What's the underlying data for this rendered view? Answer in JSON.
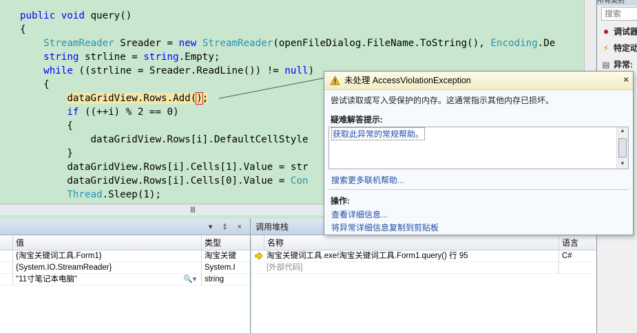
{
  "editor": {
    "lines": [
      [
        {
          "t": "public",
          "c": "kw"
        },
        {
          "t": " "
        },
        {
          "t": "void",
          "c": "kw"
        },
        {
          "t": " query()"
        }
      ],
      [
        {
          "t": "{"
        }
      ],
      [
        {
          "t": "    "
        },
        {
          "t": "StreamReader",
          "c": "ty"
        },
        {
          "t": " Sreader = "
        },
        {
          "t": "new",
          "c": "kw"
        },
        {
          "t": " "
        },
        {
          "t": "StreamReader",
          "c": "ty"
        },
        {
          "t": "(openFileDialog.FileName.ToString(), "
        },
        {
          "t": "Encoding",
          "c": "ty"
        },
        {
          "t": ".De"
        }
      ],
      [
        {
          "t": "    "
        },
        {
          "t": "string",
          "c": "kw"
        },
        {
          "t": " strline = "
        },
        {
          "t": "string",
          "c": "kw"
        },
        {
          "t": ".Empty;"
        }
      ],
      [
        {
          "t": "    "
        },
        {
          "t": "while",
          "c": "kw"
        },
        {
          "t": " ((strline = Sreader.ReadLine()) != "
        },
        {
          "t": "null",
          "c": "kw"
        },
        {
          "t": ")"
        }
      ],
      [
        {
          "t": "    {"
        }
      ],
      [
        {
          "t": "        "
        },
        {
          "t": "dataGridView.Rows.Add(",
          "c": "hl"
        },
        {
          "t": ")",
          "c": "hl hl-paren"
        },
        {
          "t": ";",
          "c": "hl"
        }
      ],
      [
        {
          "t": "        "
        },
        {
          "t": "if",
          "c": "kw"
        },
        {
          "t": " ((++i) % 2 == 0)"
        }
      ],
      [
        {
          "t": "        {"
        }
      ],
      [
        {
          "t": "            dataGridView.Rows[i].DefaultCellStyle"
        }
      ],
      [
        {
          "t": "        }"
        }
      ],
      [
        {
          "t": "        dataGridView.Rows[i].Cells[1].Value = str"
        }
      ],
      [
        {
          "t": "        dataGridView.Rows[i].Cells[0].Value = "
        },
        {
          "t": "Con",
          "c": "ty"
        }
      ],
      [
        {
          "t": "        "
        },
        {
          "t": "Thread",
          "c": "ty"
        },
        {
          "t": ".Sleep(1);"
        }
      ]
    ],
    "hscroll_grip": "III"
  },
  "locals": {
    "title": "",
    "buttons": "▾ ‡ ×",
    "columns": {
      "value": "值",
      "type": "类型"
    },
    "rows": [
      {
        "value": "{淘宝关键词工具.Form1}",
        "type": "淘宝关键"
      },
      {
        "value": "{System.IO.StreamReader}",
        "type": "System.I"
      },
      {
        "value": "\"11寸笔记本电脑\"",
        "type": "string",
        "has_viewer": true
      }
    ]
  },
  "callstack": {
    "title": "调用堆栈",
    "columns": {
      "name": "名称",
      "lang": "语言"
    },
    "rows": [
      {
        "name": "淘宝关键词工具.exe!淘宝关键词工具.Form1.query() 行 95",
        "lang": "C#",
        "current": true
      },
      {
        "name": "[外部代码]",
        "lang": "",
        "external": true
      }
    ]
  },
  "right_panel": {
    "title": "所有类别",
    "search_placeholder": "搜索",
    "items": [
      {
        "icon": "record-icon",
        "glyph": "⏺",
        "label": "调试器"
      },
      {
        "icon": "lightning-icon",
        "glyph": "⚡",
        "label": "特定动"
      },
      {
        "icon": "document-icon",
        "glyph": "▤",
        "label": "异常:"
      }
    ]
  },
  "exception": {
    "title": "未处理 AccessViolationException",
    "message": "尝试读取或写入受保护的内存。这通常指示其他内存已损坏。",
    "tips_header": "疑难解答提示:",
    "tips_link": "获取此异常的常规帮助。",
    "search_link": "搜索更多联机帮助...",
    "actions_header": "操作:",
    "action_links": [
      "查看详细信息...",
      "将异常详细信息复制到剪贴板"
    ],
    "close": "×"
  },
  "colors": {
    "editor_bg": "#c9e7cf",
    "keyword": "#0000ff",
    "type": "#2b91af",
    "highlight": "#f6e7a6",
    "link": "#1f4da6"
  }
}
